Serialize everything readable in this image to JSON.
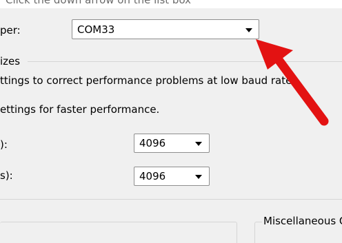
{
  "top_caption": "Click the down arrow on the list box",
  "port_row": {
    "label": "per:",
    "selected_value": "COM33"
  },
  "buffer_group": {
    "title": "izes",
    "line1": "ttings to correct performance problems at low baud rates.",
    "line2": "ettings for faster performance.",
    "receive": {
      "label": "):",
      "selected_value": "4096"
    },
    "transmit": {
      "label": "s):",
      "selected_value": "4096"
    }
  },
  "misc_group": {
    "title": "Miscellaneous Options"
  },
  "annotation": {
    "color": "#e31212",
    "icon": "red-arrow"
  }
}
